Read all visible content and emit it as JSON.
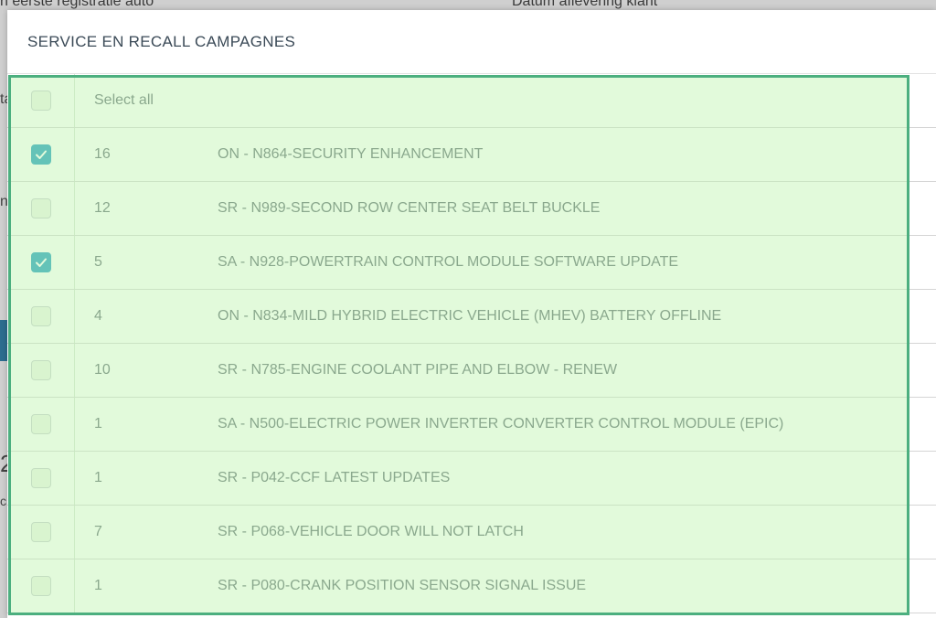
{
  "background": {
    "left_label": "n eerste registratie auto",
    "right_label": "Datum aflevering klant",
    "side_fragments": [
      "ta",
      "n",
      "2",
      "c"
    ]
  },
  "modal": {
    "title": "SERVICE EN RECALL CAMPAGNES",
    "select_all_label": "Select all",
    "rows": [
      {
        "count": "16",
        "name": "ON - N864-SECURITY ENHANCEMENT",
        "checked": true
      },
      {
        "count": "12",
        "name": "SR - N989-SECOND ROW CENTER SEAT BELT BUCKLE",
        "checked": false
      },
      {
        "count": "5",
        "name": "SA - N928-POWERTRAIN CONTROL MODULE SOFTWARE UPDATE",
        "checked": true
      },
      {
        "count": "4",
        "name": "ON - N834-MILD HYBRID ELECTRIC VEHICLE (MHEV) BATTERY OFFLINE",
        "checked": false
      },
      {
        "count": "10",
        "name": "SR - N785-ENGINE COOLANT PIPE AND ELBOW - RENEW",
        "checked": false
      },
      {
        "count": "1",
        "name": "SA - N500-ELECTRIC POWER INVERTER CONVERTER CONTROL MODULE (EPIC)",
        "checked": false
      },
      {
        "count": "1",
        "name": "SR - P042-CCF LATEST UPDATES",
        "checked": false
      },
      {
        "count": "7",
        "name": "SR - P068-VEHICLE DOOR WILL NOT LATCH",
        "checked": false
      },
      {
        "count": "1",
        "name": "SR - P080-CRANK POSITION SENSOR SIGNAL ISSUE",
        "checked": false
      }
    ]
  },
  "colors": {
    "checkbox_checked": "#1a9cc0",
    "highlight_border": "#4caf7f"
  }
}
